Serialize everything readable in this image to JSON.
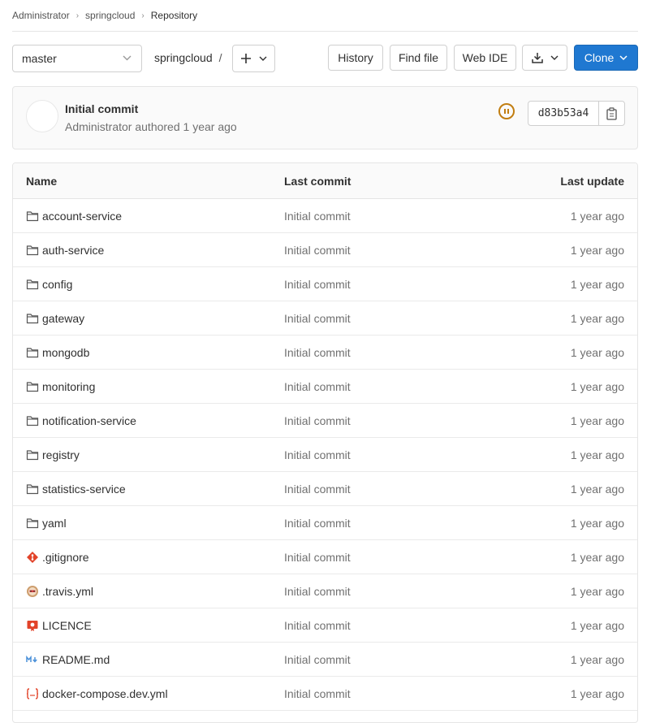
{
  "breadcrumb": [
    "Administrator",
    "springcloud",
    "Repository"
  ],
  "toolbar": {
    "branch": "master",
    "path": "springcloud",
    "path_sep": "/",
    "add_icon": "plus-icon",
    "history": "History",
    "find_file": "Find file",
    "web_ide": "Web IDE",
    "download_icon": "download-icon",
    "clone": "Clone"
  },
  "commit": {
    "title": "Initial commit",
    "meta": "Administrator authored 1 year ago",
    "sha": "d83b53a4",
    "pipeline_status_icon": "pipeline-paused-icon",
    "copy_icon": "clipboard-icon"
  },
  "table": {
    "headers": {
      "name": "Name",
      "last_commit": "Last commit",
      "last_update": "Last update"
    },
    "rows": [
      {
        "name": "account-service",
        "icon": "folder-icon",
        "commit": "Initial commit",
        "updated": "1 year ago"
      },
      {
        "name": "auth-service",
        "icon": "folder-icon",
        "commit": "Initial commit",
        "updated": "1 year ago"
      },
      {
        "name": "config",
        "icon": "folder-icon",
        "commit": "Initial commit",
        "updated": "1 year ago"
      },
      {
        "name": "gateway",
        "icon": "folder-icon",
        "commit": "Initial commit",
        "updated": "1 year ago"
      },
      {
        "name": "mongodb",
        "icon": "folder-icon",
        "commit": "Initial commit",
        "updated": "1 year ago"
      },
      {
        "name": "monitoring",
        "icon": "folder-icon",
        "commit": "Initial commit",
        "updated": "1 year ago"
      },
      {
        "name": "notification-service",
        "icon": "folder-icon",
        "commit": "Initial commit",
        "updated": "1 year ago"
      },
      {
        "name": "registry",
        "icon": "folder-icon",
        "commit": "Initial commit",
        "updated": "1 year ago"
      },
      {
        "name": "statistics-service",
        "icon": "folder-icon",
        "commit": "Initial commit",
        "updated": "1 year ago"
      },
      {
        "name": "yaml",
        "icon": "folder-icon",
        "commit": "Initial commit",
        "updated": "1 year ago"
      },
      {
        "name": ".gitignore",
        "icon": "git-icon",
        "commit": "Initial commit",
        "updated": "1 year ago"
      },
      {
        "name": ".travis.yml",
        "icon": "travis-icon",
        "commit": "Initial commit",
        "updated": "1 year ago"
      },
      {
        "name": "LICENCE",
        "icon": "license-icon",
        "commit": "Initial commit",
        "updated": "1 year ago"
      },
      {
        "name": "README.md",
        "icon": "markdown-icon",
        "commit": "Initial commit",
        "updated": "1 year ago"
      },
      {
        "name": "docker-compose.dev.yml",
        "icon": "yaml-icon",
        "commit": "Initial commit",
        "updated": "1 year ago"
      }
    ]
  },
  "colors": {
    "clone_button": "#1f78d1",
    "pipeline_status": "#c17d10",
    "icon_red": "#e24329"
  }
}
